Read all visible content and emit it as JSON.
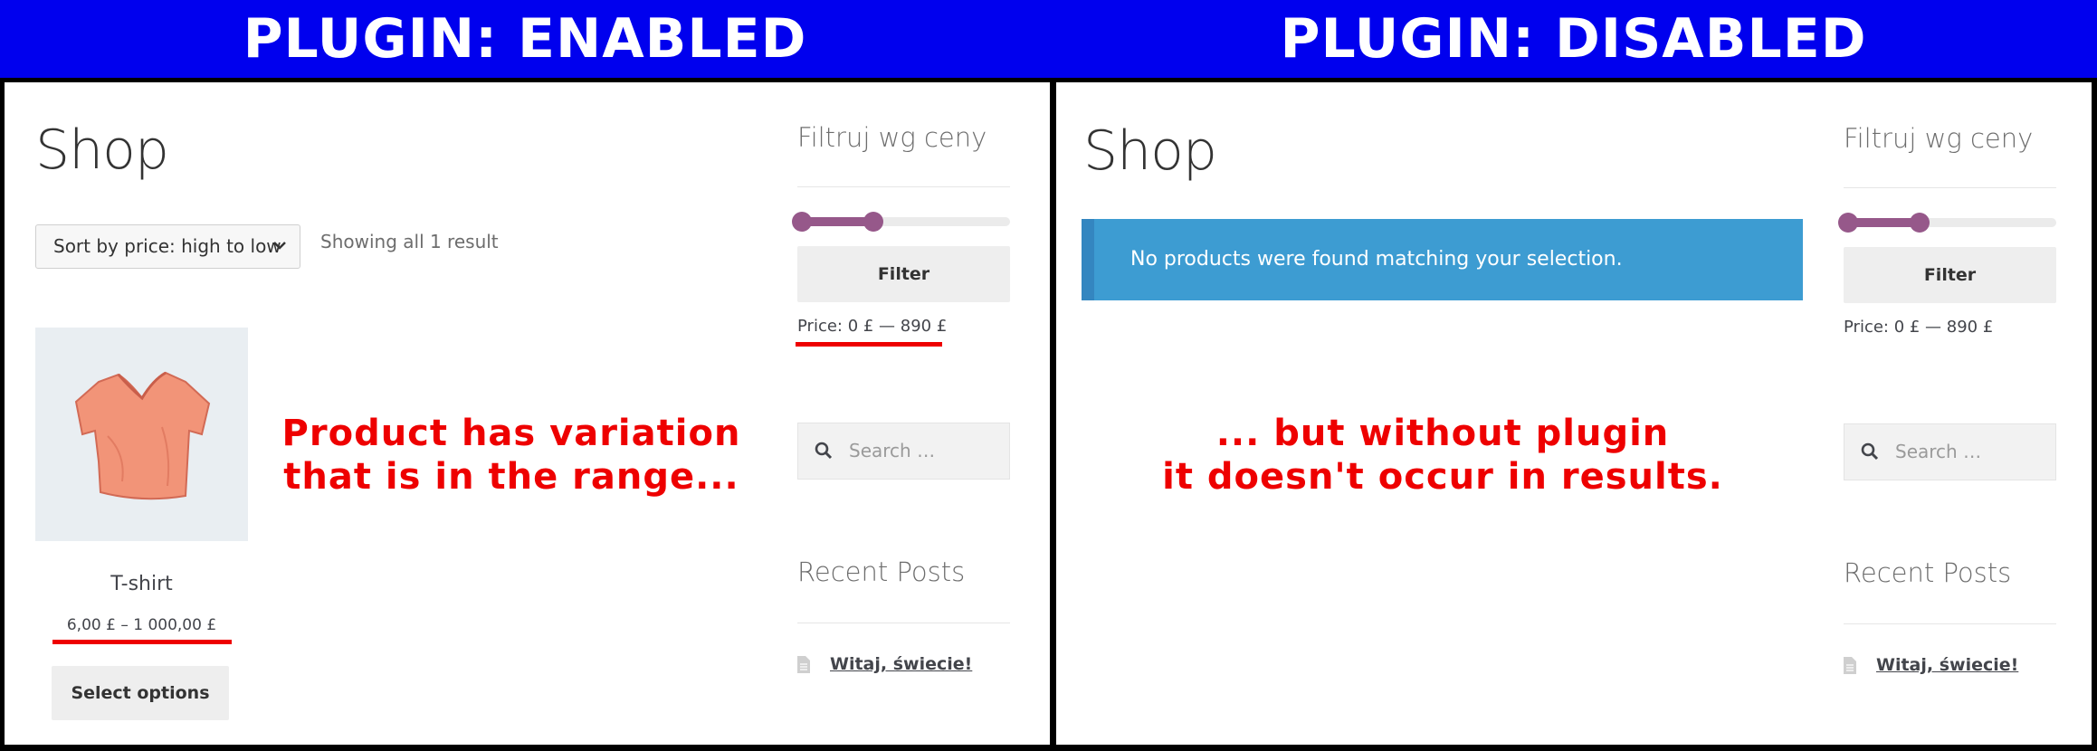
{
  "banners": {
    "left": "PLUGIN: ENABLED",
    "right": "PLUGIN: DISABLED"
  },
  "left_panel": {
    "shop_title": "Shop",
    "sort_select": {
      "value": "Sort by price: high to low",
      "icon": "chevron-down-icon"
    },
    "result_count": "Showing all 1 result",
    "product": {
      "image_icon": "t-shirt-image",
      "name": "T-shirt",
      "price": "6,00 £ – 1 000,00 £",
      "button_label": "Select options"
    },
    "annotation_lines": [
      "Product has variation",
      "that is in the range..."
    ],
    "sidebar": {
      "filter_title": "Filtruj wg ceny",
      "price_slider": {
        "min_fraction": 0.0,
        "max_fraction": 0.36
      },
      "filter_button": "Filter",
      "price_label": "Price: 0 £ — 890 £",
      "search_placeholder": "Search …",
      "recent_posts_title": "Recent Posts",
      "recent_post": "Witaj, świecie!"
    }
  },
  "right_panel": {
    "shop_title": "Shop",
    "notice": "No products were found matching your selection.",
    "annotation_lines": [
      "... but without plugin",
      "it doesn't occur in results."
    ],
    "sidebar": {
      "filter_title": "Filtruj wg ceny",
      "price_slider": {
        "min_fraction": 0.0,
        "max_fraction": 0.36
      },
      "filter_button": "Filter",
      "price_label": "Price: 0 £ — 890 £",
      "search_placeholder": "Search …",
      "recent_posts_title": "Recent Posts",
      "recent_post": "Witaj, świecie!"
    }
  },
  "colors": {
    "banner": "#0000ee",
    "annotation": "#ee0000",
    "slider": "#96588a",
    "notice": "#3d9cd2"
  }
}
